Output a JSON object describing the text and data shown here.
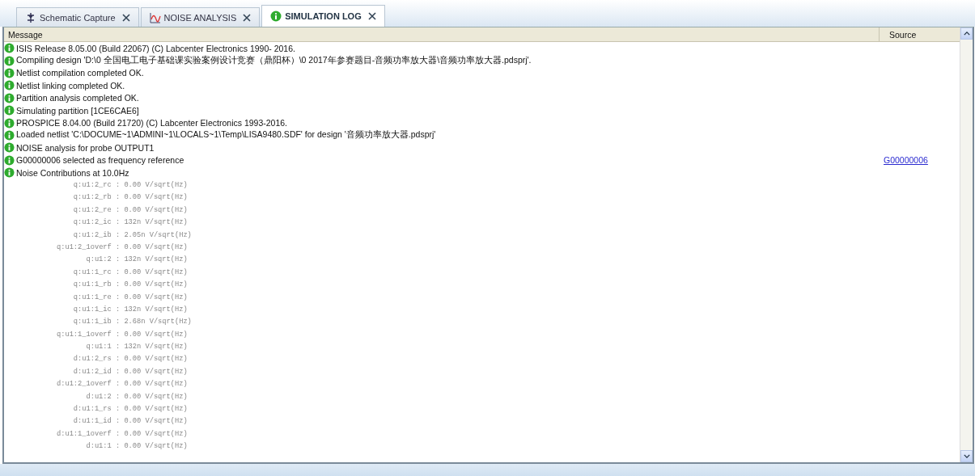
{
  "tabs": [
    {
      "label": "Schematic Capture",
      "kind": "schematic",
      "selected": false
    },
    {
      "label": "NOISE ANALYSIS",
      "kind": "graph",
      "selected": false
    },
    {
      "label": "SIMULATION LOG",
      "kind": "info",
      "selected": true
    }
  ],
  "table": {
    "columns": [
      "Message",
      "Source"
    ],
    "rows": [
      {
        "kind": "info",
        "text": "ISIS Release 8.05.00 (Build 22067) (C) Labcenter Electronics 1990- 2016."
      },
      {
        "kind": "info",
        "text": "Compiling design 'D:\\0 全国电工电子基础课实验案例设计竞赛（鼎阳杯）\\0 2017年参赛题目-音频功率放大器\\音频功率放大器.pdsprj'."
      },
      {
        "kind": "info",
        "text": "Netlist compilation completed OK."
      },
      {
        "kind": "info",
        "text": "Netlist linking completed OK."
      },
      {
        "kind": "info",
        "text": "Partition analysis completed OK."
      },
      {
        "kind": "info",
        "text": "Simulating partition [1CE6CAE6]"
      },
      {
        "kind": "info",
        "text": "PROSPICE 8.04.00 (Build 21720) (C) Labcenter Electronics 1993-2016."
      },
      {
        "kind": "info",
        "text": "Loaded netlist 'C:\\DOCUME~1\\ADMINI~1\\LOCALS~1\\Temp\\LISA9480.SDF' for design '音频功率放大器.pdsprj'"
      },
      {
        "kind": "info",
        "text": "NOISE analysis for probe OUTPUT1"
      },
      {
        "kind": "info",
        "text": "G00000006 selected as frequency reference",
        "source": "G00000006"
      },
      {
        "kind": "info",
        "text": "Noise Contributions at 10.0Hz"
      },
      {
        "kind": "value",
        "text": "q:u1:2_rc : 0.00 V/sqrt(Hz)"
      },
      {
        "kind": "value",
        "text": "q:u1:2_rb : 0.00 V/sqrt(Hz)"
      },
      {
        "kind": "value",
        "text": "q:u1:2_re : 0.00 V/sqrt(Hz)"
      },
      {
        "kind": "value",
        "text": "q:u1:2_ic : 132n V/sqrt(Hz)"
      },
      {
        "kind": "value",
        "text": "q:u1:2_ib : 2.05n V/sqrt(Hz)"
      },
      {
        "kind": "value",
        "text": "q:u1:2_1overf : 0.00 V/sqrt(Hz)"
      },
      {
        "kind": "value",
        "text": "q:u1:2 : 132n V/sqrt(Hz)"
      },
      {
        "kind": "value",
        "text": "q:u1:1_rc : 0.00 V/sqrt(Hz)"
      },
      {
        "kind": "value",
        "text": "q:u1:1_rb : 0.00 V/sqrt(Hz)"
      },
      {
        "kind": "value",
        "text": "q:u1:1_re : 0.00 V/sqrt(Hz)"
      },
      {
        "kind": "value",
        "text": "q:u1:1_ic : 132n V/sqrt(Hz)"
      },
      {
        "kind": "value",
        "text": "q:u1:1_ib : 2.68n V/sqrt(Hz)"
      },
      {
        "kind": "value",
        "text": "q:u1:1_1overf : 0.00 V/sqrt(Hz)"
      },
      {
        "kind": "value",
        "text": "q:u1:1 : 132n V/sqrt(Hz)"
      },
      {
        "kind": "value",
        "text": "d:u1:2_rs : 0.00 V/sqrt(Hz)"
      },
      {
        "kind": "value",
        "text": "d:u1:2_id : 0.00 V/sqrt(Hz)"
      },
      {
        "kind": "value",
        "text": "d:u1:2_1overf : 0.00 V/sqrt(Hz)"
      },
      {
        "kind": "value",
        "text": "d:u1:2 : 0.00 V/sqrt(Hz)"
      },
      {
        "kind": "value",
        "text": "d:u1:1_rs : 0.00 V/sqrt(Hz)"
      },
      {
        "kind": "value",
        "text": "d:u1:1_id : 0.00 V/sqrt(Hz)"
      },
      {
        "kind": "value",
        "text": "d:u1:1_1overf : 0.00 V/sqrt(Hz)"
      },
      {
        "kind": "value",
        "text": "d:u1:1 : 0.00 V/sqrt(Hz)"
      }
    ]
  }
}
